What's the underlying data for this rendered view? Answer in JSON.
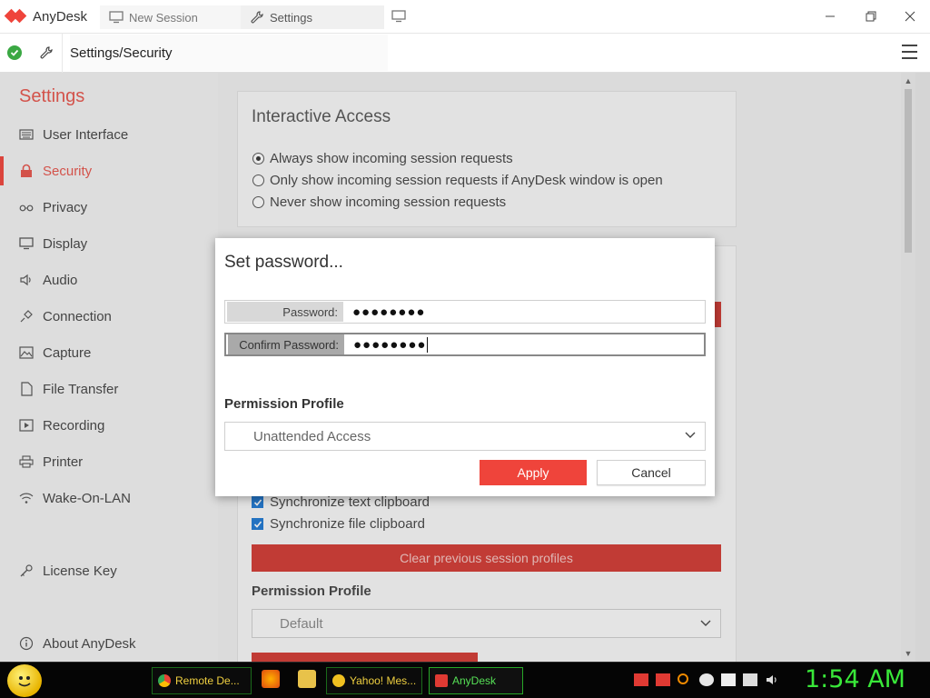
{
  "app": {
    "name": "AnyDesk",
    "brand_color": "#ef443b"
  },
  "tabs": [
    {
      "label": "New Session",
      "icon": "monitor-icon"
    },
    {
      "label": "Settings",
      "icon": "wrench-icon"
    }
  ],
  "address": {
    "path": "Settings/Security",
    "status": "connected-check-icon"
  },
  "sidebar": {
    "title": "Settings",
    "items": [
      {
        "label": "User Interface",
        "icon": "keyboard-icon"
      },
      {
        "label": "Security",
        "icon": "lock-icon",
        "active": true
      },
      {
        "label": "Privacy",
        "icon": "glasses-icon"
      },
      {
        "label": "Display",
        "icon": "monitor-icon"
      },
      {
        "label": "Audio",
        "icon": "speaker-icon"
      },
      {
        "label": "Connection",
        "icon": "plug-icon"
      },
      {
        "label": "Capture",
        "icon": "image-icon"
      },
      {
        "label": "File Transfer",
        "icon": "file-icon"
      },
      {
        "label": "Recording",
        "icon": "video-icon"
      },
      {
        "label": "Printer",
        "icon": "printer-icon"
      },
      {
        "label": "Wake-On-LAN",
        "icon": "wifi-icon"
      },
      {
        "label": "License Key",
        "icon": "key-icon"
      },
      {
        "label": "About AnyDesk",
        "icon": "info-icon"
      }
    ]
  },
  "interactive_access": {
    "title": "Interactive Access",
    "options": [
      {
        "label": "Always show incoming session requests",
        "selected": true
      },
      {
        "label": "Only show incoming session requests if AnyDesk window is open",
        "selected": false
      },
      {
        "label": "Never show incoming session requests",
        "selected": false
      }
    ]
  },
  "background": {
    "checks": [
      {
        "label": "Synchronize text clipboard",
        "checked": true
      },
      {
        "label": "Synchronize file clipboard",
        "checked": true
      }
    ],
    "clear_button": "Clear previous session profiles",
    "permission_label": "Permission Profile",
    "permission_value": "Default"
  },
  "dialog": {
    "title": "Set password...",
    "password_label": "Password:",
    "password_value": "●●●●●●●●",
    "confirm_label": "Confirm Password:",
    "confirm_value": "●●●●●●●●",
    "permission_label": "Permission Profile",
    "permission_value": "Unattended Access",
    "apply_label": "Apply",
    "cancel_label": "Cancel"
  },
  "taskbar": {
    "items": [
      {
        "label": "Remote De...",
        "icon": "chrome-icon"
      },
      {
        "label": "Yahoo! Mes...",
        "icon": "yahoo-messenger-icon"
      },
      {
        "label": "AnyDesk",
        "icon": "anydesk-icon",
        "active": true
      }
    ],
    "clock": "1:54 AM"
  }
}
